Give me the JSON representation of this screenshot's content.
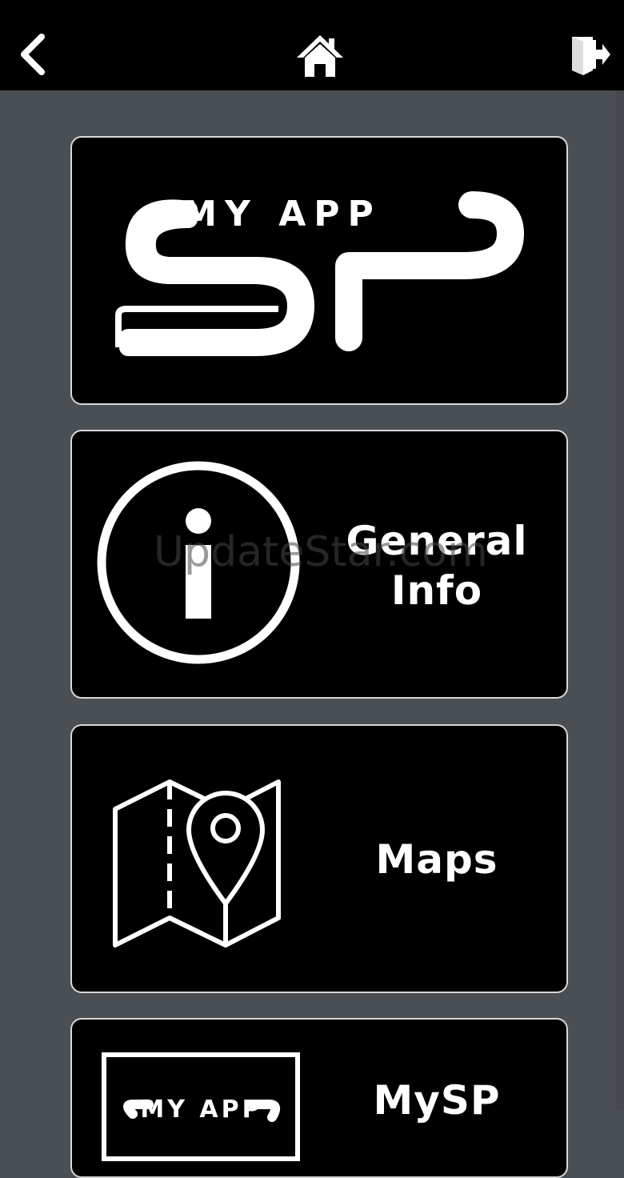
{
  "header": {
    "back_icon": "chevron-left-icon",
    "home_icon": "home-icon",
    "logout_icon": "exit-door-icon"
  },
  "tiles": [
    {
      "logo_text": "MY APP",
      "logo_mark": "SP"
    },
    {
      "label_line1": "General",
      "label_line2": "Info",
      "icon": "info-circle-icon"
    },
    {
      "label": "Maps",
      "icon": "map-pin-icon"
    },
    {
      "label": "MySP",
      "icon": "my-app-logo-thumbnail",
      "logo_text": "MY APP"
    }
  ],
  "watermark": "UpdateStar.com",
  "colors": {
    "background": "#4a4f54",
    "topbar": "#000000",
    "tile": "#000000",
    "tile_border": "#d8d8d8",
    "foreground": "#ffffff"
  }
}
